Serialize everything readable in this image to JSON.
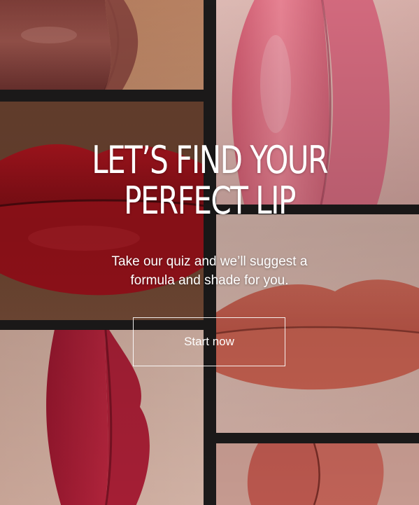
{
  "hero": {
    "headline_line1": "LET’S FIND YOUR",
    "headline_line2": "PERFECT LIP",
    "subtext_line1": "Take our quiz and we’ll suggest a",
    "subtext_line2": "formula and shade for you.",
    "cta_label": "Start now"
  },
  "colors": {
    "text": "#ffffff",
    "grid_gap": "#1e1c1c",
    "tile_1_lip": "#8e4a44",
    "tile_2_lip": "#e07586",
    "tile_3_lip": "#a8141e",
    "tile_4_lip": "#d4685a",
    "tile_5_lip": "#b01c34",
    "tile_6_lip": "#c85e54"
  }
}
